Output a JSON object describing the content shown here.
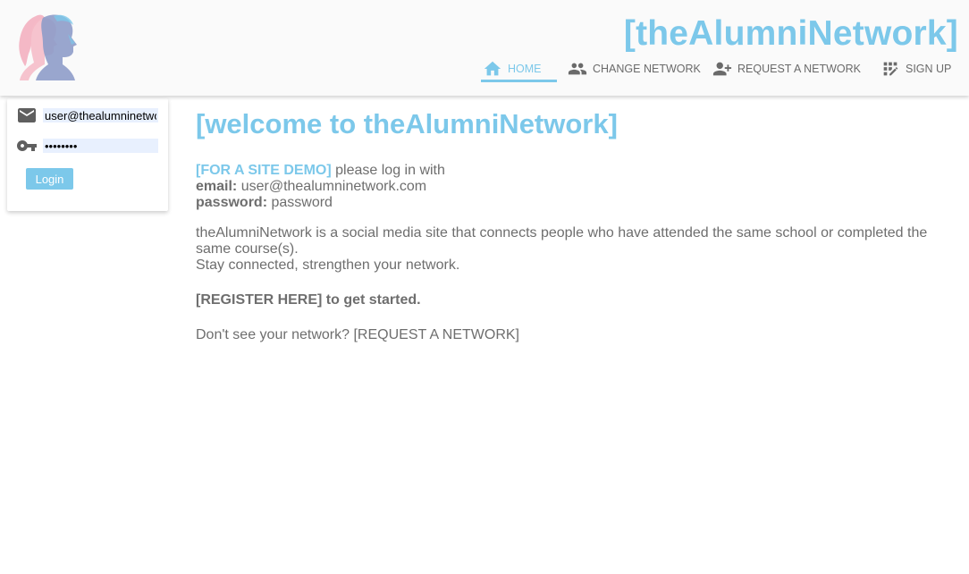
{
  "header": {
    "site_title": "[theAlumniNetwork]",
    "nav": [
      {
        "label": "HOME",
        "icon": "home-icon",
        "active": true
      },
      {
        "label": "CHANGE NETWORK",
        "icon": "people-icon",
        "active": false
      },
      {
        "label": "REQUEST A NETWORK",
        "icon": "person-add-icon",
        "active": false
      },
      {
        "label": "SIGN UP",
        "icon": "app-registration-icon",
        "active": false
      }
    ]
  },
  "login": {
    "email_value": "user@thealumninetwork.com",
    "password_mask": "••••••••",
    "button_label": "Login"
  },
  "main": {
    "welcome": "[welcome to theAlumniNetwork]",
    "demo_link": "[FOR A SITE DEMO]",
    "demo_text": " please log in with",
    "email_label": "email:",
    "email_value": " user@thealumninetwork.com",
    "password_label": "password:",
    "password_value": " password",
    "description_1": "theAlumniNetwork is a social media site that connects people who have attended the same school or completed the same course(s).",
    "description_2": "Stay connected, strengthen your network.",
    "register_link": "[REGISTER HERE]",
    "register_text": " to get started.",
    "request_text": "Don't see your network? ",
    "request_link": "[REQUEST A NETWORK]"
  },
  "colors": {
    "accent": "#7cc8ea",
    "text": "#6e6e6e",
    "logo_pink": "#f4b8c6",
    "logo_silhouette": "#8e9cc9"
  }
}
